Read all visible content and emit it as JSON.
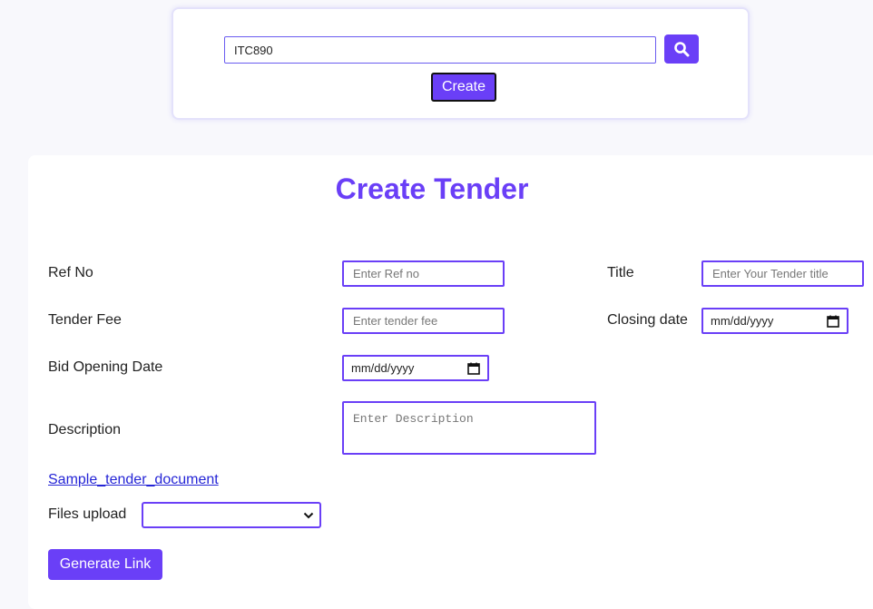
{
  "search": {
    "value": "ITC890",
    "create_label": "Create"
  },
  "form": {
    "title": "Create Tender",
    "ref_no": {
      "label": "Ref No",
      "placeholder": "Enter Ref no"
    },
    "title_field": {
      "label": "Title",
      "placeholder": "Enter Your Tender title"
    },
    "tender_fee": {
      "label": "Tender Fee",
      "placeholder": "Enter tender fee"
    },
    "closing_date": {
      "label": "Closing date",
      "value": "mm/dd/yyyy"
    },
    "bid_opening_date": {
      "label": "Bid Opening Date",
      "value": "mm/dd/yyyy"
    },
    "description": {
      "label": "Description",
      "placeholder": "Enter Description"
    },
    "sample_link": "Sample_tender_document",
    "files_upload": {
      "label": "Files upload",
      "selected": ""
    },
    "generate_label": "Generate Link"
  },
  "colors": {
    "accent": "#6a3ff7",
    "link": "#2525d6"
  }
}
